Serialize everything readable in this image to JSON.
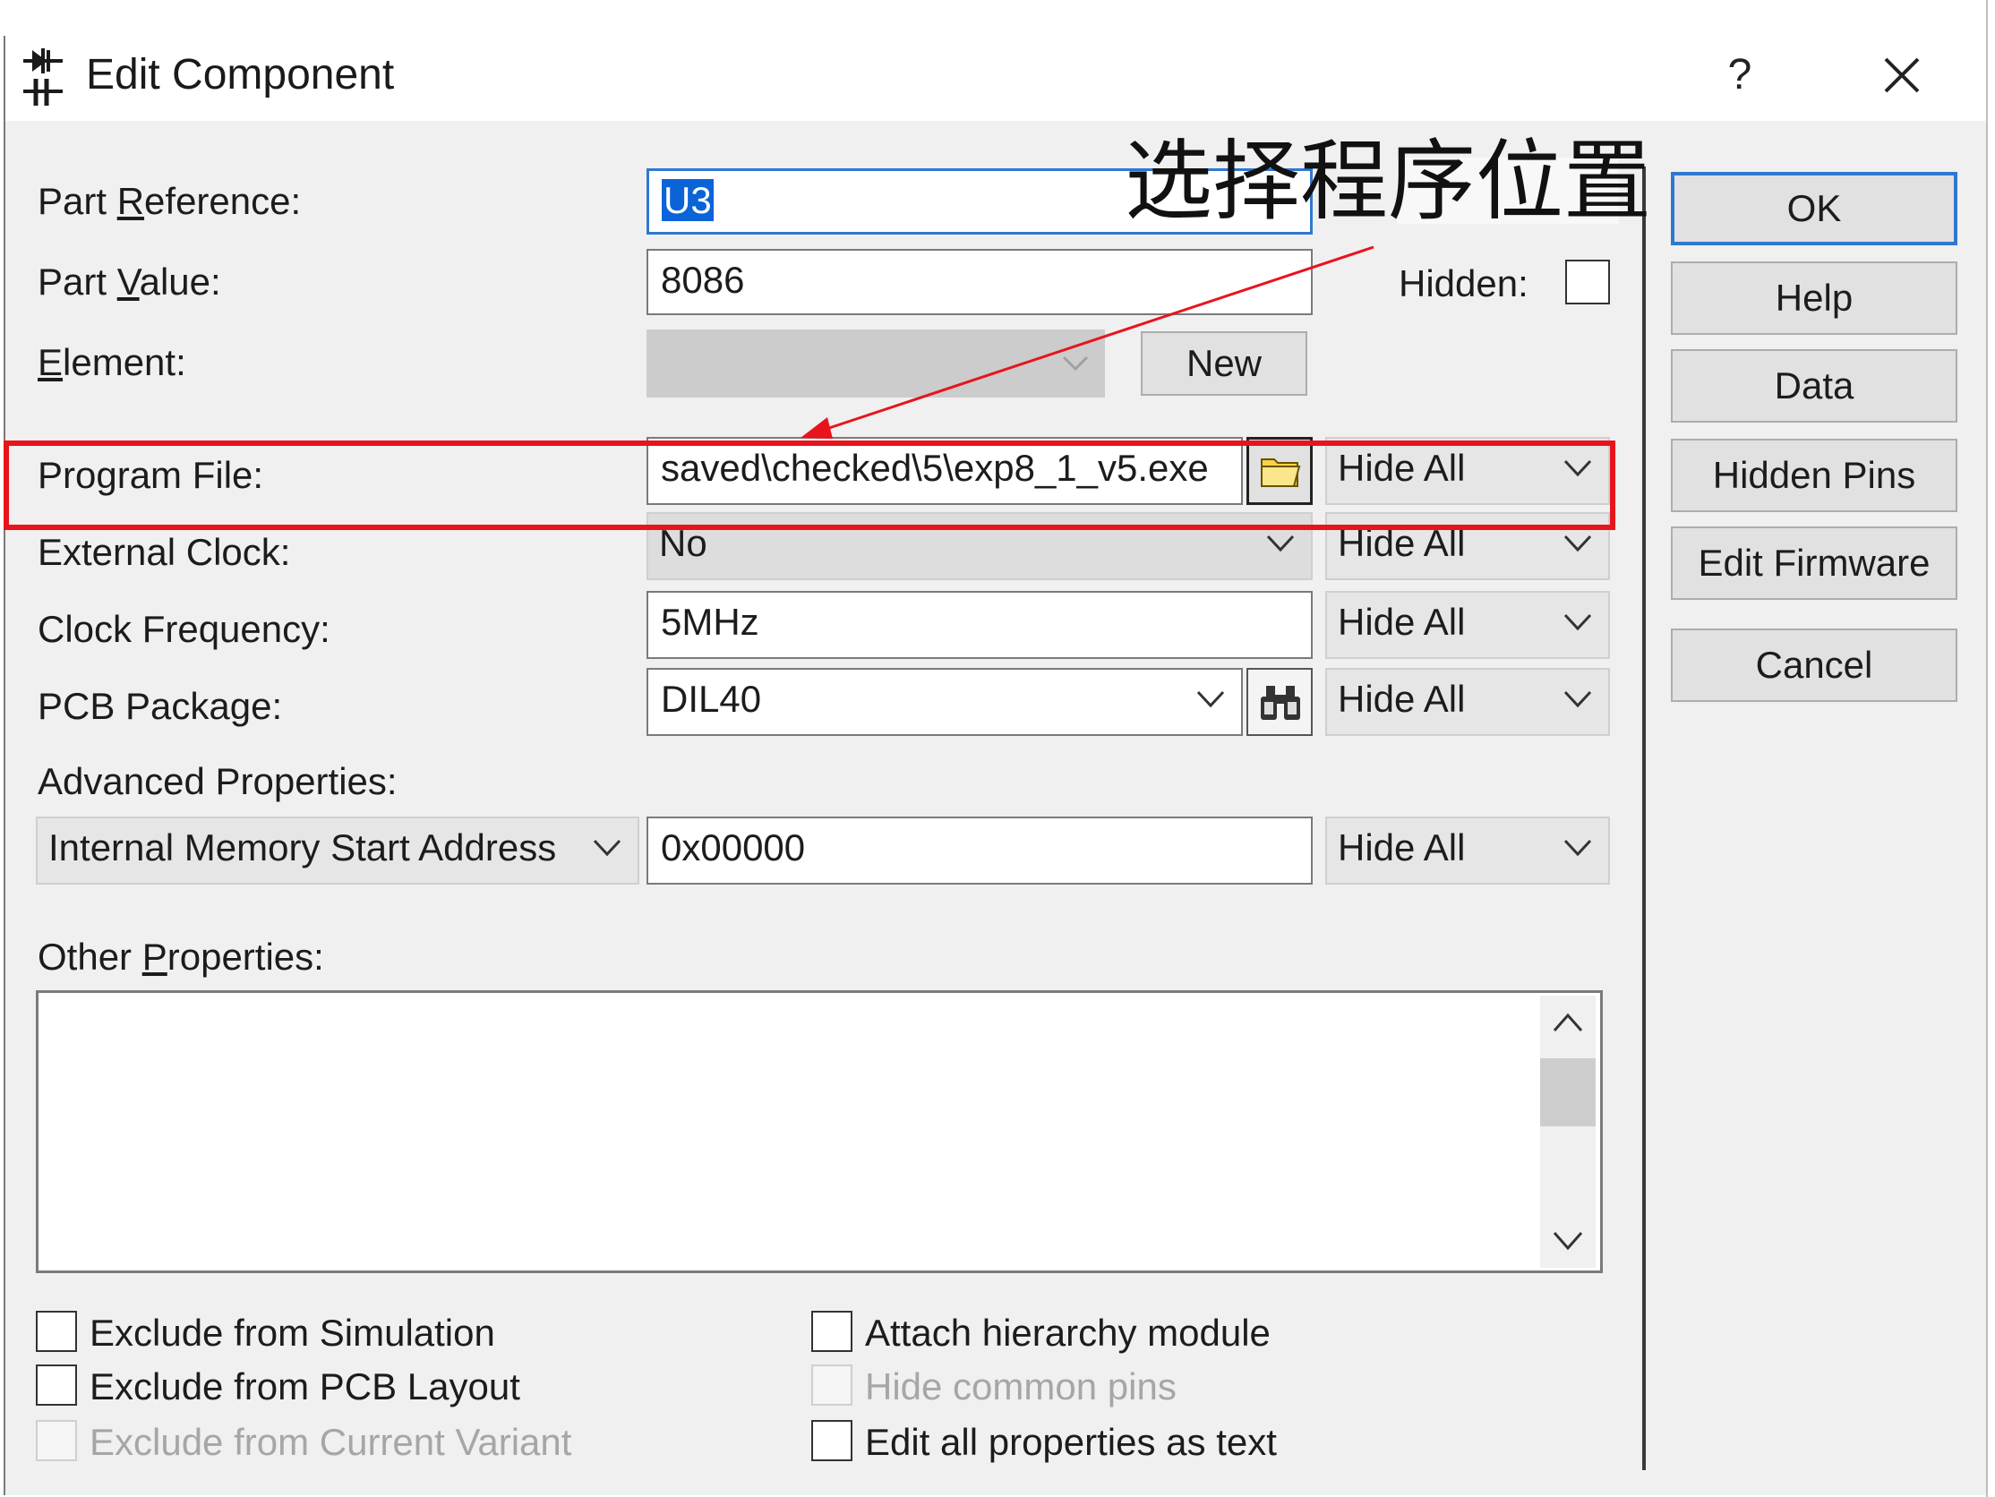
{
  "window": {
    "title": "Edit Component",
    "help_glyph": "?",
    "close_icon": "close-icon"
  },
  "labels": {
    "part_reference_pre": "Part ",
    "part_reference_acc": "R",
    "part_reference_post": "eference:",
    "part_value_pre": "Part ",
    "part_value_acc": "V",
    "part_value_post": "alue:",
    "element_acc": "E",
    "element_post": "lement:",
    "program_file": "Program File:",
    "external_clock": "External Clock:",
    "clock_frequency": "Clock Frequency:",
    "pcb_package": "PCB Package:",
    "advanced_properties": "Advanced Properties:",
    "other_properties_pre": "Other ",
    "other_properties_acc": "P",
    "other_properties_post": "roperties:",
    "hidden": "Hidden:"
  },
  "fields": {
    "part_reference": "U3",
    "part_value": "8086",
    "element": "",
    "program_file": "saved\\checked\\5\\exp8_1_v5.exe",
    "external_clock": "No",
    "clock_frequency": "5MHz",
    "pcb_package": "DIL40",
    "advanced_property": "Internal Memory Start Address",
    "advanced_value": "0x00000",
    "other_properties": ""
  },
  "visibility": {
    "program_file": "Hide All",
    "external_clock": "Hide All",
    "clock_frequency": "Hide All",
    "pcb_package": "Hide All",
    "advanced": "Hide All"
  },
  "buttons": {
    "new": "New",
    "ok": "OK",
    "help": "Help",
    "data": "Data",
    "hidden_pins": "Hidden Pins",
    "edit_firmware": "Edit Firmware",
    "cancel": "Cancel"
  },
  "checkboxes": {
    "exclude_simulation": "Exclude from Simulation",
    "exclude_pcb": "Exclude from PCB Layout",
    "exclude_variant": "Exclude from Current Variant",
    "attach_hierarchy": "Attach hierarchy module",
    "hide_common_pins": "Hide common pins",
    "edit_all_text": "Edit all properties as text"
  },
  "annotation": {
    "text": "选择程序位置",
    "highlight_color": "#e8141c",
    "arrow_color": "#e8141c"
  },
  "colors": {
    "selection": "#0a64d8",
    "default_button_border": "#2f78d0"
  }
}
